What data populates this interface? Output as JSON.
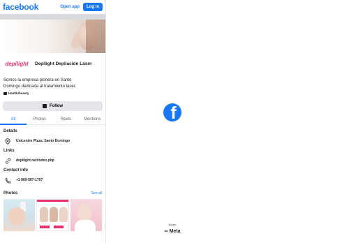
{
  "header": {
    "logo": "facebook",
    "open_app": "Open app",
    "login": "Log in"
  },
  "profile": {
    "avatar_text": "depilight",
    "name": "Depilight Depilación Láser",
    "about": "Somos la empresa pionera en Santo Domingo dedicada al tratamiento láser.",
    "category": "Health/beauty",
    "follow_label": "Follow"
  },
  "tabs": [
    "All",
    "Photos",
    "Reels",
    "Mentions"
  ],
  "details": {
    "title": "Details",
    "location": "Unicentro Plaza, Santo Domingo"
  },
  "links": {
    "title": "Links",
    "url": "depilight.net/index.php"
  },
  "contact": {
    "title": "Contact info",
    "phone": "+1 809-567-1707"
  },
  "photos": {
    "title": "Photos",
    "see_all": "See all"
  },
  "footer": {
    "from": "from",
    "meta": "Meta"
  },
  "colors": {
    "brand": "#1877f2",
    "accent_pink": "#e7336f"
  }
}
